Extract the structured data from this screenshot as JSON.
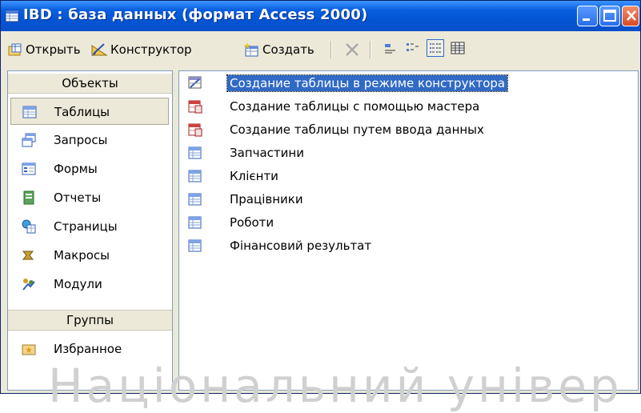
{
  "window": {
    "title": "IBD : база данных (формат Access 2000)",
    "controls": {
      "minimize": "minimize-icon",
      "maximize": "maximize-icon",
      "close": "close-icon"
    }
  },
  "toolbar": {
    "open_label": "Открыть",
    "design_label": "Конструктор",
    "create_label": "Создать",
    "icons": [
      "open-icon",
      "design-icon",
      "create-icon",
      "delete-icon",
      "large-icons-view-icon",
      "small-icons-view-icon",
      "list-view-icon",
      "details-view-icon"
    ],
    "active_view": "list"
  },
  "objects": {
    "header": "Объекты",
    "items": [
      {
        "label": "Таблицы",
        "icon": "table-icon"
      },
      {
        "label": "Запросы",
        "icon": "query-icon"
      },
      {
        "label": "Формы",
        "icon": "form-icon"
      },
      {
        "label": "Отчеты",
        "icon": "report-icon"
      },
      {
        "label": "Страницы",
        "icon": "page-icon"
      },
      {
        "label": "Макросы",
        "icon": "macro-icon"
      },
      {
        "label": "Модули",
        "icon": "module-icon"
      }
    ],
    "selected_index": 0
  },
  "groups": {
    "header": "Группы",
    "items": [
      {
        "label": "Избранное",
        "icon": "favorites-icon"
      }
    ]
  },
  "list": {
    "items": [
      {
        "label": "Создание таблицы в режиме конструктора",
        "icon": "design-wizard-icon"
      },
      {
        "label": "Создание таблицы с помощью мастера",
        "icon": "wizard-icon"
      },
      {
        "label": "Создание таблицы путем ввода данных",
        "icon": "wizard-icon"
      },
      {
        "label": "Запчастини",
        "icon": "table-icon"
      },
      {
        "label": "Клієнти",
        "icon": "table-icon"
      },
      {
        "label": "Працівники",
        "icon": "table-icon"
      },
      {
        "label": "Роботи",
        "icon": "table-icon"
      },
      {
        "label": "Фінансовий результат",
        "icon": "table-icon"
      }
    ],
    "selected_index": 0
  },
  "watermark": "Національний універ"
}
